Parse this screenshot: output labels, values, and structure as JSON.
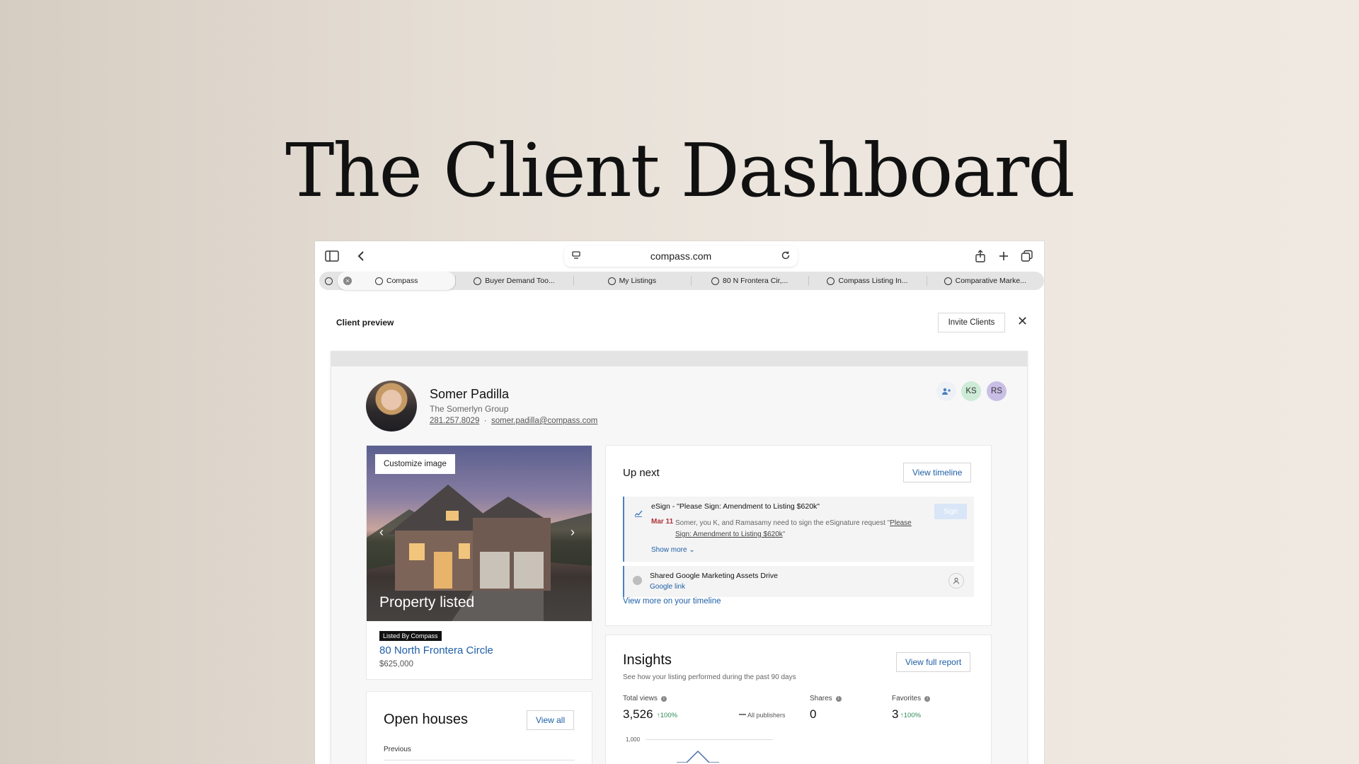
{
  "hero": {
    "title": "The Client Dashboard"
  },
  "browser": {
    "url": "compass.com",
    "tabs": [
      {
        "label": "Compass",
        "active": true
      },
      {
        "label": "Buyer Demand Too..."
      },
      {
        "label": "My Listings"
      },
      {
        "label": "80 N Frontera Cir,..."
      },
      {
        "label": "Compass Listing In..."
      },
      {
        "label": "Comparative Marke..."
      }
    ]
  },
  "preview": {
    "title": "Client preview",
    "invite_label": "Invite Clients",
    "close_label": "✕"
  },
  "agent": {
    "name": "Somer Padilla",
    "group": "The Somerlyn Group",
    "phone": "281.257.8029",
    "separator": "·",
    "email": "somer.padilla@compass.com",
    "collaborators": [
      {
        "initials": "KS",
        "color": "#cdebd7"
      },
      {
        "initials": "RS",
        "color": "#c9bfe6"
      }
    ]
  },
  "listing": {
    "customize_label": "Customize image",
    "prev_arrow": "‹",
    "next_arrow": "›",
    "caption": "Property listed",
    "badge": "Listed By Compass",
    "address": "80 North Frontera Circle",
    "price": "$625,000"
  },
  "open_houses": {
    "title": "Open houses",
    "view_all_label": "View all",
    "previous_label": "Previous"
  },
  "up_next": {
    "title": "Up next",
    "view_timeline_label": "View timeline",
    "tasks": [
      {
        "title": "eSign - \"Please Sign: Amendment to Listing $620k\"",
        "date": "Mar 11",
        "body_prefix": "Somer, you K, and Ramasamy need to sign the eSignature request \"",
        "body_link": "Please Sign: Amendment to Listing $620k",
        "body_suffix": "\"",
        "show_more": "Show more",
        "sign_label": "Sign"
      },
      {
        "title": "Shared Google Marketing Assets Drive",
        "link": "Google link"
      }
    ],
    "more_link": "View more on your timeline"
  },
  "insights": {
    "title": "Insights",
    "subtitle": "See how your listing performed during the past 90 days",
    "view_report_label": "View full report",
    "metrics": [
      {
        "label": "Total views",
        "value": "3,526",
        "change": "↑100%"
      },
      {
        "label": "Shares",
        "value": "0"
      },
      {
        "label": "Favorites",
        "value": "3",
        "change": "↑100%"
      }
    ],
    "legend": "All publishers",
    "axis_label": "1,000"
  },
  "colors": {
    "accent_blue": "#1f5fa6",
    "date_red": "#b0333a",
    "positive_green": "#2e8b57"
  }
}
